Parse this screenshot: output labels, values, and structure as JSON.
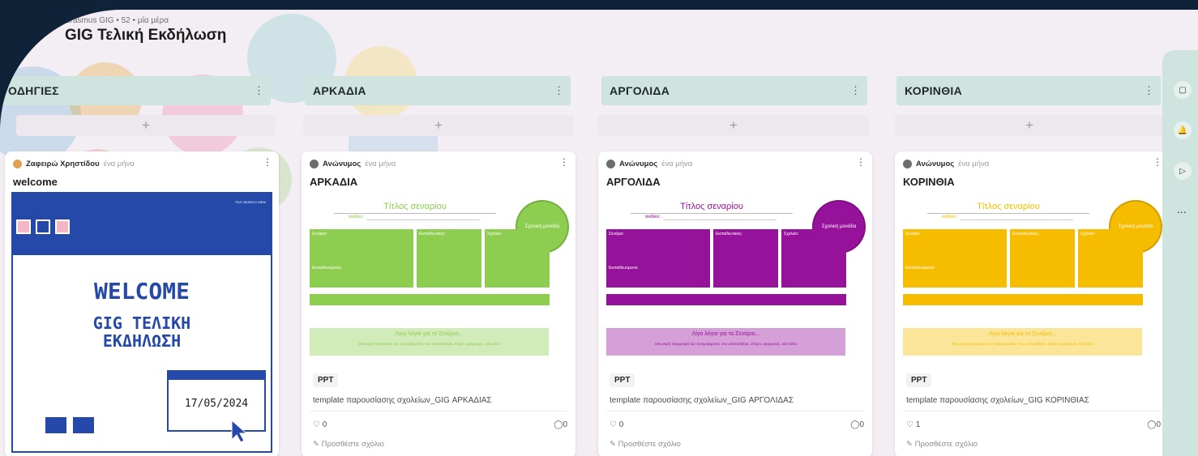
{
  "header": {
    "meta": "Erasmus GIG • 52 • μία μέρα",
    "title": "GIG Τελική Εκδήλωση"
  },
  "columns": [
    {
      "name": "ΟΔΗΓΙΕΣ",
      "menu": "⋮",
      "add": "+"
    },
    {
      "name": "ΑΡΚΑΔΙΑ",
      "menu": "⋮",
      "add": "+"
    },
    {
      "name": "ΑΡΓΟΛΙΔΑ",
      "menu": "⋮",
      "add": "+"
    },
    {
      "name": "ΚΟΡΙΝΘΙΑ",
      "menu": "⋮",
      "add": "+"
    }
  ],
  "welcome_card": {
    "author": "Ζαφειρώ Χρηστίδου",
    "time": "ένα μήνα",
    "title": "welcome",
    "menu_text": "FILE  SEARCH  VIEW",
    "big1": "WELCOME",
    "big2a": "GIG ΤΕΛΙΚΗ",
    "big2b": "ΕΚΔΗΛΩΣΗ",
    "date": "17/05/2024"
  },
  "cards": [
    {
      "author": "Ανώνυμος",
      "time": "ένα μήνα",
      "title": "ΑΡΚΑΔΙΑ",
      "accent": "#8dcd4f",
      "thumb_title": "Τίτλος σεναρίου",
      "webex": "webex:",
      "circle": "Σχολική μονάδα",
      "b1": "Σενάριο:",
      "b2": "Εκπαιδευτικός:",
      "b3": "Σχολείο:",
      "b4": "Εκπαιδευόμενοι:",
      "b5": "Στόχοι σεναρίου:",
      "strip_title": "Λίγα λόγια για το Σενάριο...",
      "strip_text": "Μια μικρή περιγραφή του προγράμματος που υλοποιήθηκε. Στόχοι, εφαρμογή...κάτι άλλο",
      "chip": "PPT",
      "attachment": "template παρουσίασης σχολείων_GIG ΑΡΚΑΔΙΑΣ",
      "likes": "0",
      "comments": "0",
      "add_comment": "Προσθέστε σχόλιο"
    },
    {
      "author": "Ανώνυμος",
      "time": "ένα μήνα",
      "title": "ΑΡΓΟΛΙΔΑ",
      "accent": "#97129a",
      "thumb_title": "Τίτλος σεναρίου",
      "webex": "webex:",
      "circle": "Σχολική μονάδα",
      "b1": "Σενάριο:",
      "b2": "Εκπαιδευτικός:",
      "b3": "Σχολείο:",
      "b4": "Εκπαιδευόμενοι:",
      "b5": "Στόχοι σεναρίου:",
      "strip_title": "Λίγα λόγια για το Σενάριο...",
      "strip_text": "Μια μικρή περιγραφή του προγράμματος που υλοποιήθηκε. Στόχοι, εφαρμογή...κάτι άλλο",
      "chip": "PPT",
      "attachment": "template παρουσίασης σχολείων_GIG ΑΡΓΟΛΙΔΑΣ",
      "likes": "0",
      "comments": "0",
      "add_comment": "Προσθέστε σχόλιο"
    },
    {
      "author": "Ανώνυμος",
      "time": "ένα μήνα",
      "title": "ΚΟΡΙΝΘΙΑ",
      "accent": "#f6bd00",
      "thumb_title": "Τίτλος σεναρίου",
      "webex": "webex:",
      "circle": "Σχολική μονάδα",
      "b1": "Σενάριο:",
      "b2": "Εκπαιδευτικός:",
      "b3": "Σχολείο:",
      "b4": "Εκπαιδευόμενοι:",
      "b5": "Στόχοι σεναρίου:",
      "strip_title": "Λίγα λόγια για το Σενάριο...",
      "strip_text": "Μια μικρή περιγραφή του προγράμματος που υλοποιήθηκε. Στόχοι, εφαρμογή...κάτι άλλο",
      "chip": "PPT",
      "attachment": "template παρουσίασης σχολείων_GIG ΚΟΡΙΝΘΙΑΣ",
      "likes": "1",
      "comments": "0",
      "add_comment": "Προσθέστε σχόλιο"
    }
  ],
  "rail": {
    "more": "..."
  },
  "icons": [
    "heart-icon",
    "comment-icon",
    "add-comment-icon",
    "bell-icon",
    "play-icon",
    "square-icon",
    "kebab-icon",
    "plus-icon"
  ]
}
